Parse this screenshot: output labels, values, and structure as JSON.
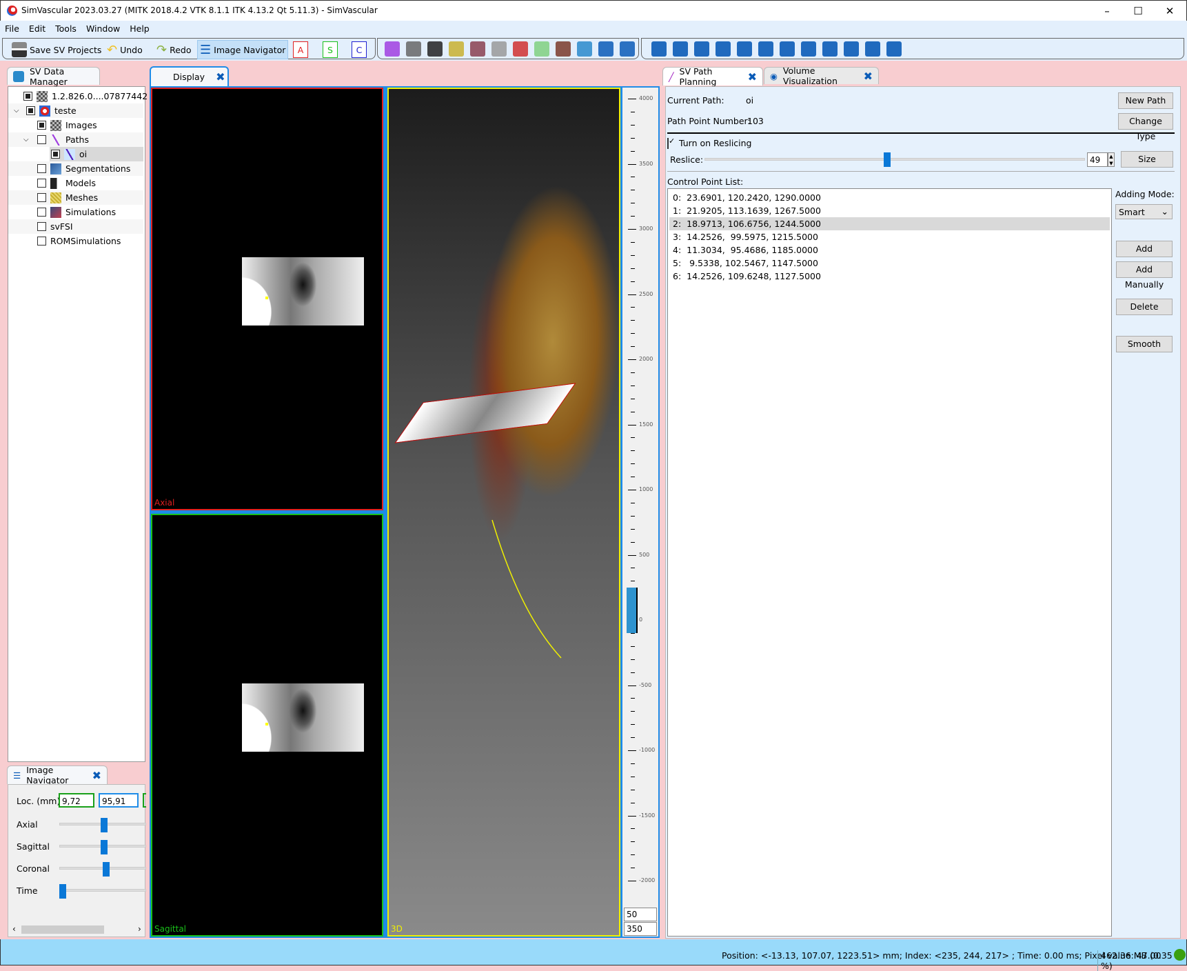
{
  "window": {
    "title": "SimVascular 2023.03.27 (MITK 2018.4.2 VTK 8.1.1 ITK 4.13.2 Qt 5.11.3) - SimVascular",
    "minimize": "–",
    "maximize": "☐",
    "close": "✕"
  },
  "menu": [
    "File",
    "Edit",
    "Tools",
    "Window",
    "Help"
  ],
  "toolbar": {
    "save": "Save SV Projects",
    "undo": "Undo",
    "redo": "Redo",
    "image_navigator": "Image Navigator",
    "axial": "A",
    "sagittal": "S",
    "coronal": "C",
    "icons": [
      "path-icon",
      "segmentation-icon",
      "model-icon",
      "mesh-icon",
      "simulation-icon",
      "fork-icon",
      "rom-icon",
      "fsi-icon",
      "vessel-icon",
      "data-manager-icon",
      "edit-icon",
      "tools-icon"
    ],
    "icons2": [
      "archive-icon",
      "print-icon",
      "help-icon",
      "help-box-icon",
      "zoom-help-icon",
      "paint-icon",
      "log-icon",
      "measure-icon",
      "properties-icon",
      "python-icon",
      "chart-icon",
      "eye-icon"
    ]
  },
  "colors": {
    "accent": "#0a78d7",
    "axial": "#e02020",
    "sagittal": "#19c019",
    "coronal": "#2020d0",
    "view3d": "#f0f000",
    "background": "#f8cdd0",
    "status": "#99dafa"
  },
  "data_manager": {
    "tab": "SV Data Manager",
    "items": [
      {
        "label": "1.2.826.0....07877442",
        "checked": true,
        "icon": "image-icon"
      },
      {
        "label": "teste",
        "checked": true,
        "icon": "project-icon",
        "expanded": true
      },
      {
        "label": "Images",
        "checked": true,
        "icon": "image-icon"
      },
      {
        "label": "Paths",
        "checked": false,
        "icon": "path-icon",
        "expanded": true
      },
      {
        "label": "oi",
        "checked": true,
        "icon": "path-point-icon",
        "selected": true
      },
      {
        "label": "Segmentations",
        "checked": false,
        "icon": "segmentation-icon"
      },
      {
        "label": "Models",
        "checked": false,
        "icon": "model-icon"
      },
      {
        "label": "Meshes",
        "checked": false,
        "icon": "mesh-icon"
      },
      {
        "label": "Simulations",
        "checked": false,
        "icon": "simulation-icon"
      },
      {
        "label": "svFSI",
        "checked": false
      },
      {
        "label": "ROMSimulations",
        "checked": false
      }
    ]
  },
  "navigator": {
    "tab": "Image Navigator",
    "loc_label": "Loc. (mm)",
    "loc": [
      "9,72",
      "95,91"
    ],
    "sliders": [
      {
        "label": "Axial",
        "value": 0.4
      },
      {
        "label": "Sagittal",
        "value": 0.4
      },
      {
        "label": "Coronal",
        "value": 0.42
      },
      {
        "label": "Time",
        "value": 0
      }
    ]
  },
  "display": {
    "tab": "Display",
    "views": [
      "Axial",
      "Sagittal",
      "3D"
    ],
    "level_window": {
      "ticks": [
        "4000",
        "3500",
        "3000",
        "2500",
        "2000",
        "1500",
        "1000",
        "500",
        "0",
        "-500",
        "-1000",
        "-1500",
        "-2000"
      ],
      "level": "50",
      "window": "350"
    }
  },
  "path_planning": {
    "tabs": [
      "SV Path Planning",
      "Volume Visualization"
    ],
    "current_path_label": "Current Path:",
    "current_path": "oi",
    "point_number_label": "Path Point Number:",
    "point_number": "103",
    "new_path": "New Path",
    "change_type": "Change Type",
    "reslicing_label": "Turn on Reslicing",
    "reslicing": true,
    "reslice_label": "Reslice:",
    "reslice_value": "49",
    "reslice_fraction": 0.48,
    "size": "Size",
    "list_label": "Control Point List:",
    "points": [
      "0:  23.6901, 120.2420, 1290.0000",
      "1:  21.9205, 113.1639, 1267.5000",
      "2:  18.9713, 106.6756, 1244.5000",
      "3:  14.2526,  99.5975, 1215.5000",
      "4:  11.3034,  95.4686, 1185.0000",
      "5:   9.5338, 102.5467, 1147.5000",
      "6:  14.2526, 109.6248, 1127.5000"
    ],
    "selected_point": 2,
    "adding_mode_label": "Adding Mode:",
    "adding_mode": "Smart",
    "add": "Add",
    "add_manually": "Add Manually",
    "delete": "Delete",
    "smooth": "Smooth"
  },
  "status": {
    "text": "Position: <-13.13, 107.07, 1223.51> mm; Index: <235, 244, 217> ; Time: 0.00 ms; Pixel value: 47.00",
    "memory": "462.36 MB (0.35 %)"
  }
}
